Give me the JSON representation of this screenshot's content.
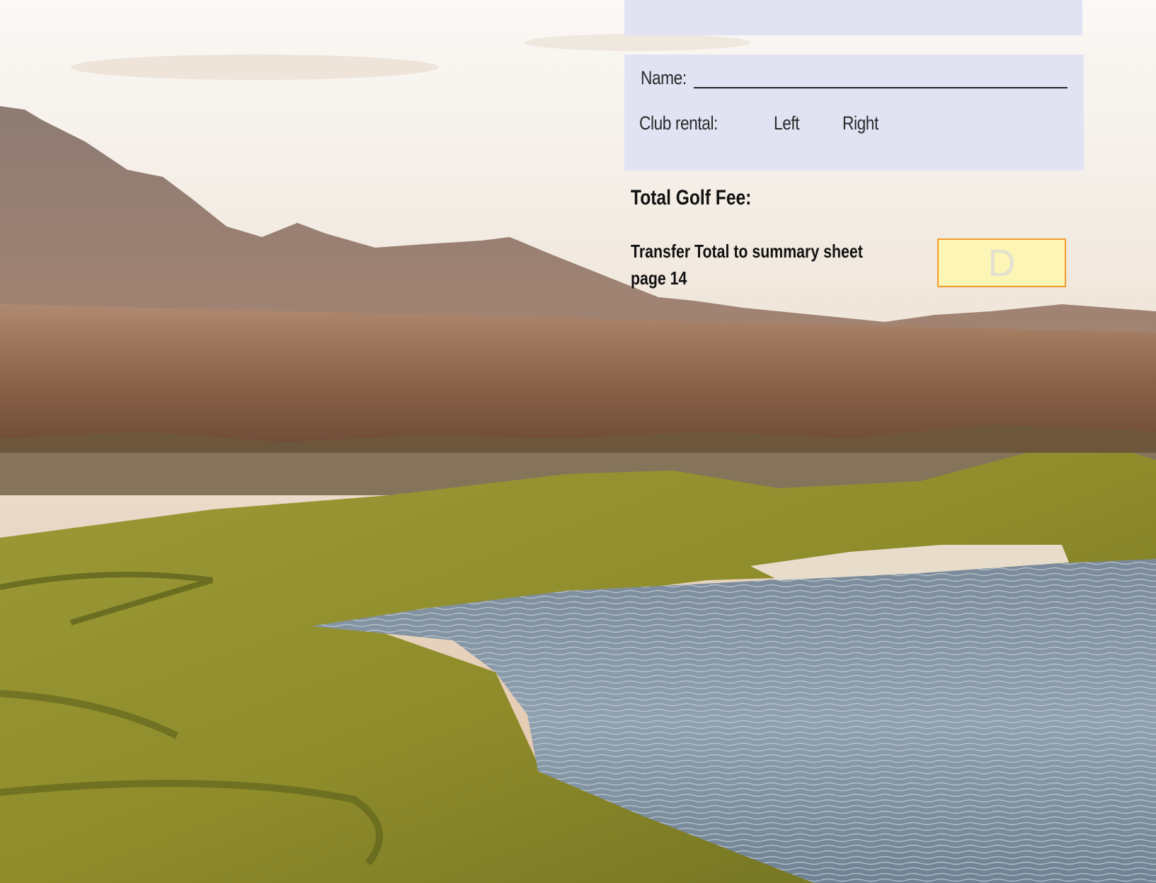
{
  "form": {
    "name_label": "Name:",
    "club_rental_label": "Club rental:",
    "club_options": [
      "Left",
      "Right"
    ]
  },
  "summary": {
    "total_label": "Total Golf Fee:",
    "transfer_text_line1": "Transfer Total to summary sheet",
    "transfer_text_line2": "page 14",
    "box_letter": "D"
  },
  "colors": {
    "panel": "#e1e3f3",
    "total_box_fill": "#fdf5b5",
    "total_box_border": "#f39b2b"
  }
}
